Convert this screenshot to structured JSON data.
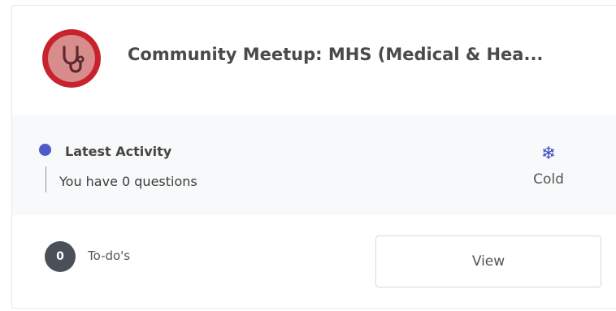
{
  "event": {
    "title": "Community Meetup: MHS (Medical & Hea...",
    "avatar_icon": "stethoscope-icon",
    "avatar_colors": {
      "ring": "#c8232d",
      "fill": "#d88c8c"
    }
  },
  "activity": {
    "heading": "Latest Activity",
    "text": "You have 0 questions",
    "dot_color": "#4e5bc6"
  },
  "temperature": {
    "icon": "snowflake-icon",
    "glyph": "❄",
    "label": "Cold"
  },
  "todos": {
    "count": "0",
    "label": "To-do's"
  },
  "actions": {
    "view_label": "View"
  }
}
